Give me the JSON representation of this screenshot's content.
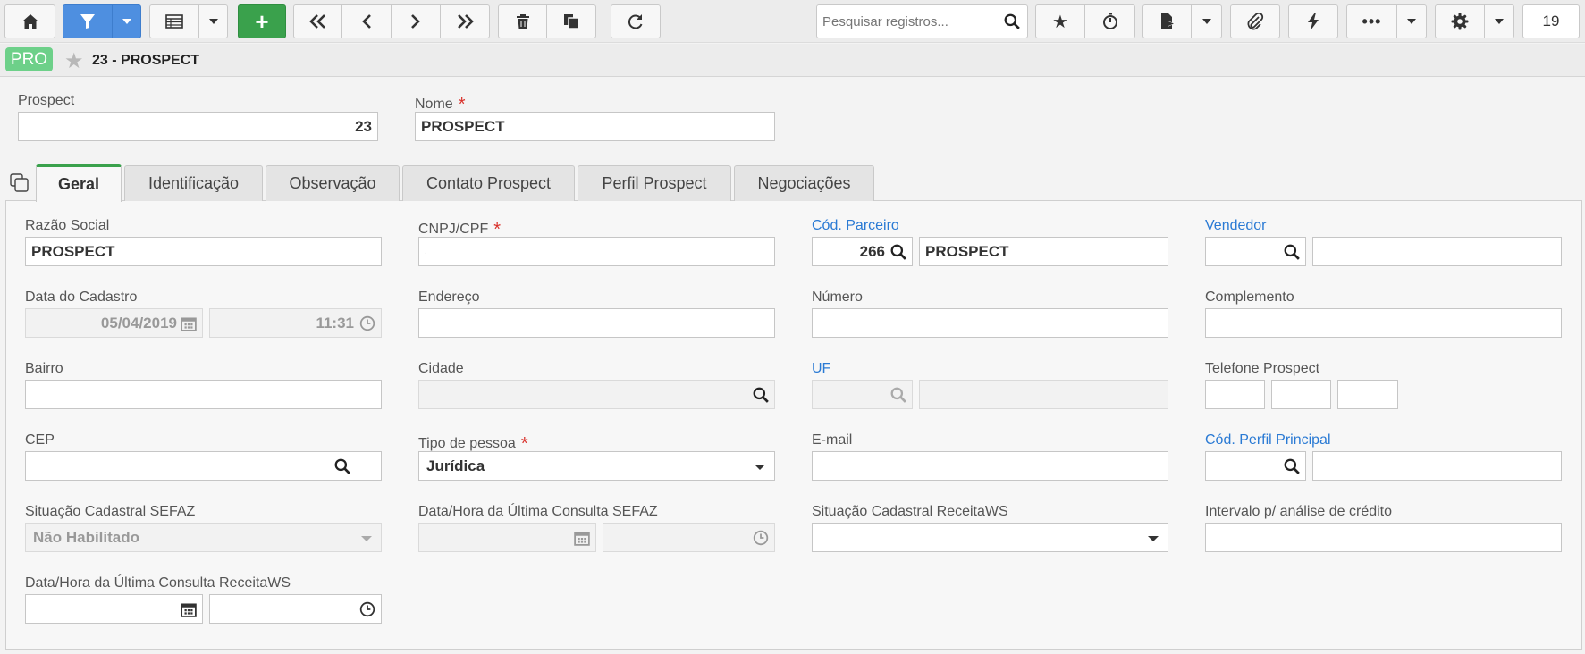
{
  "toolbar": {
    "search_placeholder": "Pesquisar registros...",
    "record_count": "19",
    "icons": [
      "home-icon",
      "filter-icon",
      "grid-icon",
      "plus-icon",
      "first-icon",
      "prev-icon",
      "next-icon",
      "last-icon",
      "trash-icon",
      "copy-icon",
      "refresh-icon",
      "star-icon",
      "timer-icon",
      "export-icon",
      "attach-icon",
      "bolt-icon",
      "more-icon",
      "gear-icon"
    ]
  },
  "header": {
    "badge": "PRO",
    "title": "23 - PROSPECT"
  },
  "top_fields": {
    "prospect_label": "Prospect",
    "prospect_value": "23",
    "nome_label": "Nome",
    "nome_value": "PROSPECT",
    "required_mark": "*"
  },
  "tabs": [
    "Geral",
    "Identificação",
    "Observação",
    "Contato Prospect",
    "Perfil Prospect",
    "Negociações"
  ],
  "form": {
    "razao_social": {
      "label": "Razão Social",
      "value": "PROSPECT"
    },
    "cnpj": {
      "label": "CNPJ/CPF",
      "value": "."
    },
    "cod_parceiro": {
      "label": "Cód. Parceiro",
      "code": "266",
      "value": "PROSPECT"
    },
    "vendedor": {
      "label": "Vendedor",
      "code": "",
      "value": ""
    },
    "data_cadastro": {
      "label": "Data do Cadastro",
      "date": "05/04/2019",
      "time": "11:31"
    },
    "endereco": {
      "label": "Endereço",
      "value": ""
    },
    "numero": {
      "label": "Número",
      "value": ""
    },
    "complemento": {
      "label": "Complemento",
      "value": ""
    },
    "bairro": {
      "label": "Bairro",
      "value": ""
    },
    "cidade": {
      "label": "Cidade",
      "value": ""
    },
    "uf": {
      "label": "UF",
      "code": "",
      "value": ""
    },
    "telefone": {
      "label": "Telefone Prospect",
      "ddi": "",
      "ddd": "",
      "numero": ""
    },
    "cep": {
      "label": "CEP",
      "value": ""
    },
    "tipo_pessoa": {
      "label": "Tipo de pessoa",
      "value": "Jurídica"
    },
    "email": {
      "label": "E-mail",
      "value": ""
    },
    "cod_perfil": {
      "label": "Cód. Perfil Principal",
      "code": "",
      "value": ""
    },
    "situacao_sefaz": {
      "label": "Situação Cadastral SEFAZ",
      "value": "Não Habilitado"
    },
    "consulta_sefaz": {
      "label": "Data/Hora da Última Consulta SEFAZ",
      "date": "",
      "time": ""
    },
    "situacao_receita": {
      "label": "Situação Cadastral ReceitaWS",
      "value": ""
    },
    "intervalo": {
      "label": "Intervalo p/ análise de crédito",
      "value": ""
    },
    "consulta_receita": {
      "label": "Data/Hora da Última Consulta ReceitaWS",
      "date": "",
      "time": ""
    }
  }
}
